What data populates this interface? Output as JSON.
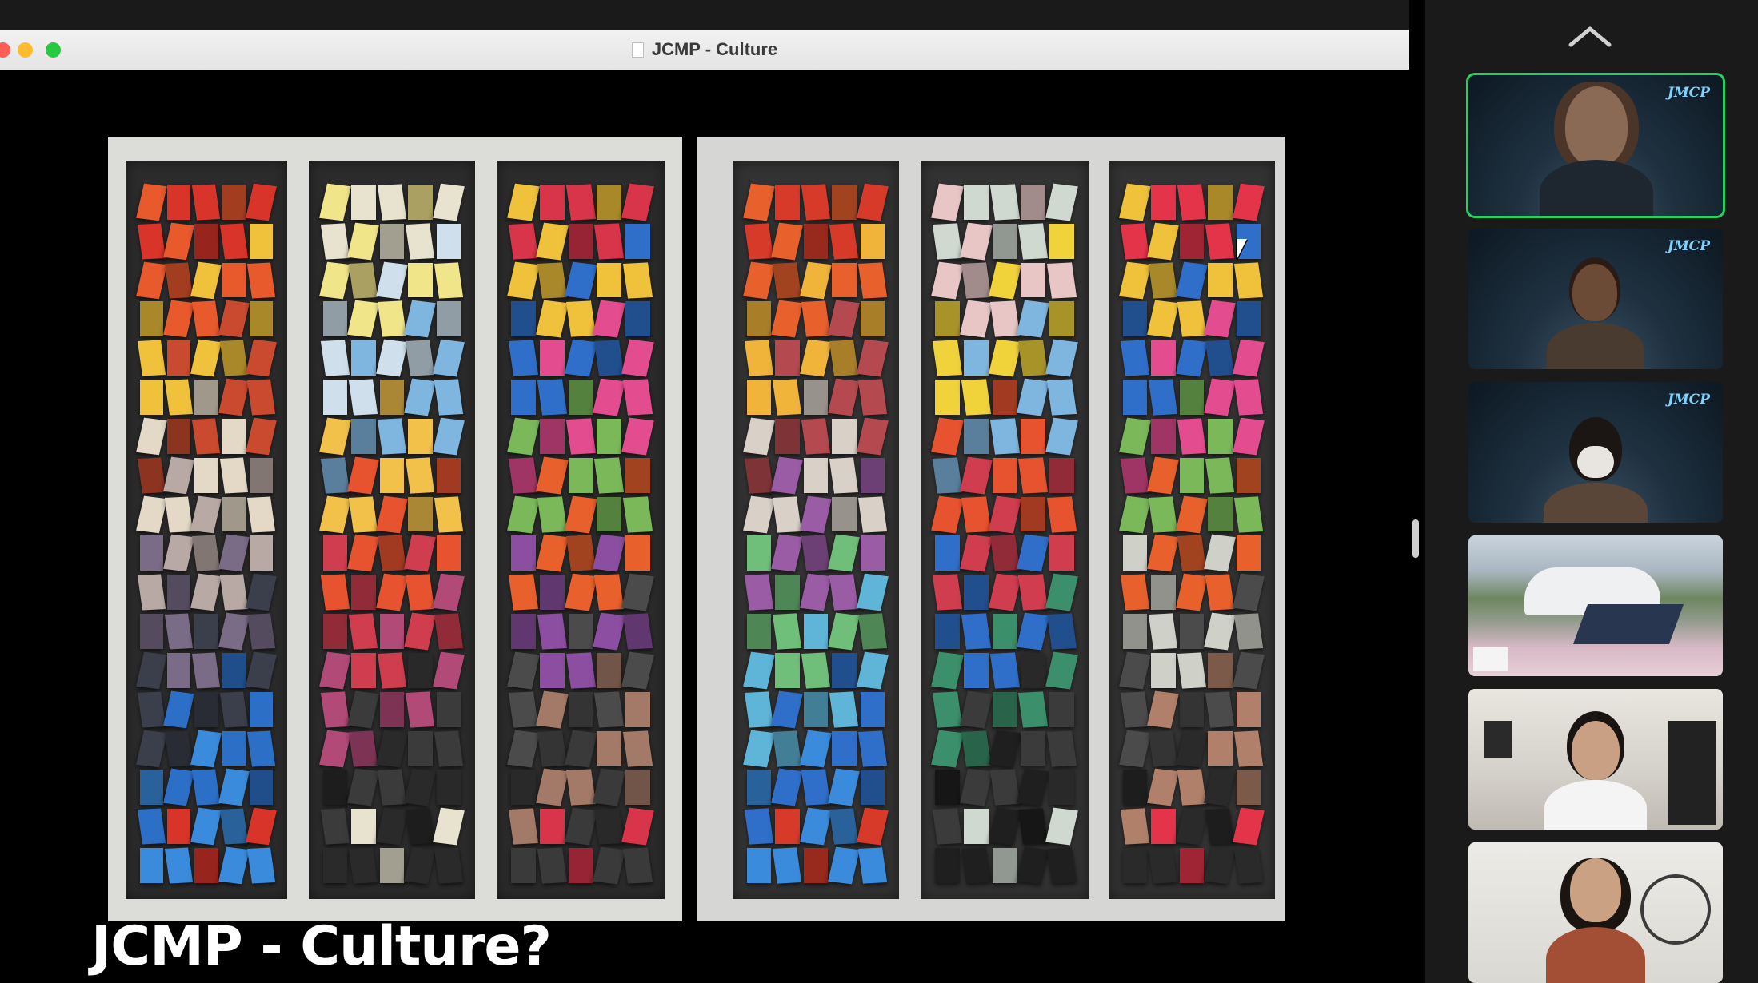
{
  "window": {
    "title": "JCMP - Culture"
  },
  "slide": {
    "caption": "JCMP - Culture?"
  },
  "sidebar": {
    "participants": [
      {
        "logo": "JMCP",
        "active": true,
        "background": "starfield"
      },
      {
        "logo": "JMCP",
        "active": false,
        "background": "starfield"
      },
      {
        "logo": "JMCP",
        "active": false,
        "background": "starfield"
      },
      {
        "logo": "",
        "active": false,
        "background": "campus"
      },
      {
        "logo": "",
        "active": false,
        "background": "room"
      },
      {
        "logo": "",
        "active": false,
        "background": "room"
      }
    ]
  },
  "colors": {
    "active_speaker_border": "#23d160",
    "titlebar_close": "#fd5f57",
    "titlebar_minimize": "#febc2e",
    "titlebar_zoom": "#28c840"
  }
}
